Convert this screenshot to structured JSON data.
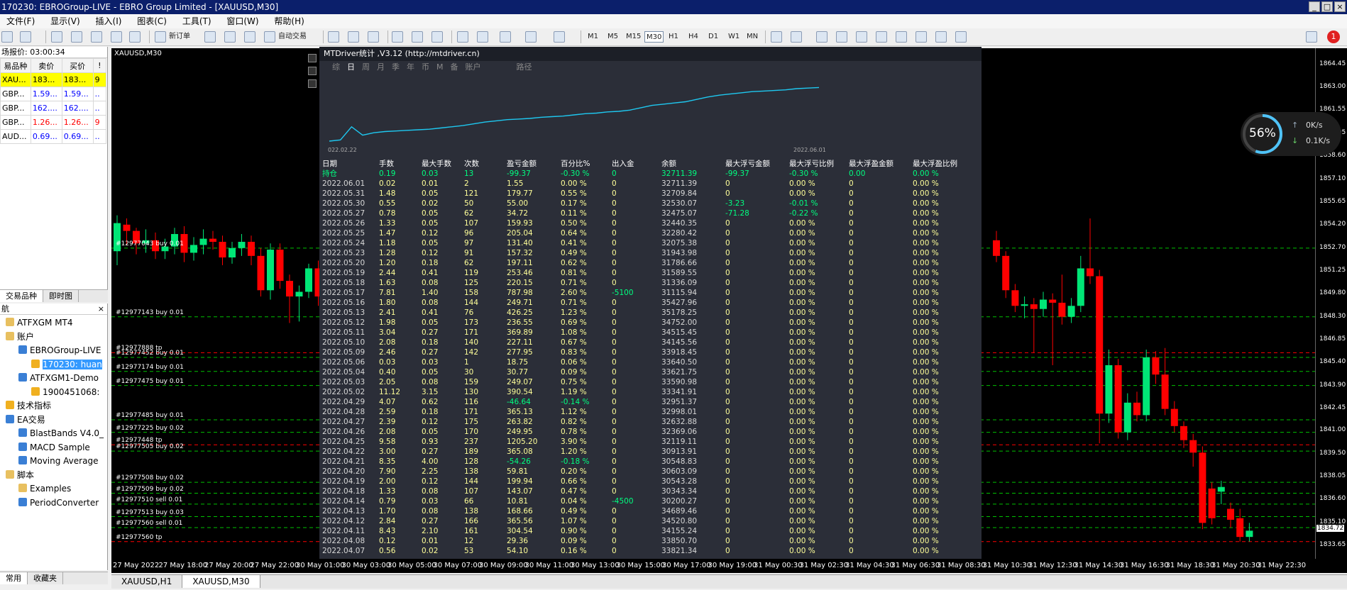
{
  "title": "170230: EBROGroup-LIVE - EBRO Group Limited - [XAUUSD,M30]",
  "window_controls": [
    "_",
    "□",
    "×"
  ],
  "menu": [
    "文件(F)",
    "显示(V)",
    "插入(I)",
    "图表(C)",
    "工具(T)",
    "窗口(W)",
    "帮助(H)"
  ],
  "toolbar": {
    "new_order": "新订单",
    "auto_trading": "自动交易",
    "timeframes": [
      "M1",
      "M5",
      "M15",
      "M30",
      "H1",
      "H4",
      "D1",
      "W1",
      "MN"
    ],
    "active_timeframe": "M30",
    "notification_count": "1"
  },
  "market_watch": {
    "header": "场报价: 03:00:34",
    "columns": [
      "易品种",
      "卖价",
      "买价",
      "!"
    ],
    "rows": [
      {
        "symbol": "XAU...",
        "bid": "183...",
        "ask": "183...",
        "spread": "9",
        "color": "#000000",
        "bg": "#ffff00"
      },
      {
        "symbol": "GBP...",
        "bid": "1.59...",
        "ask": "1.59...",
        "spread": "..",
        "color": "#0000ff",
        "bg": "#ffffff"
      },
      {
        "symbol": "GBP...",
        "bid": "162....",
        "ask": "162....",
        "spread": "..",
        "color": "#0000ff",
        "bg": "#ffffff"
      },
      {
        "symbol": "GBP...",
        "bid": "1.26...",
        "ask": "1.26...",
        "spread": "9",
        "color": "#ff0000",
        "bg": "#ffffff"
      },
      {
        "symbol": "AUD...",
        "bid": "0.69...",
        "ask": "0.69...",
        "spread": "..",
        "color": "#0000ff",
        "bg": "#ffffff"
      }
    ],
    "tabs": [
      "交易品种",
      "即时图"
    ]
  },
  "navigator": {
    "header": "航",
    "items": [
      {
        "label": "ATFXGM MT4",
        "indent": 0,
        "icon": "folder-icon"
      },
      {
        "label": "账户",
        "indent": 0,
        "icon": "accounts-icon"
      },
      {
        "label": "EBROGroup-LIVE",
        "indent": 1,
        "icon": "server-icon"
      },
      {
        "label": "170230: huan",
        "indent": 2,
        "icon": "user-icon",
        "selected": true
      },
      {
        "label": "ATFXGM1-Demo",
        "indent": 1,
        "icon": "server-icon"
      },
      {
        "label": "1900451068:",
        "indent": 2,
        "icon": "user-icon"
      },
      {
        "label": "技术指标",
        "indent": 0,
        "icon": "indicators-icon"
      },
      {
        "label": "EA交易",
        "indent": 0,
        "icon": "experts-icon"
      },
      {
        "label": "BlastBands V4.0_",
        "indent": 1,
        "icon": "expert-icon"
      },
      {
        "label": "MACD Sample",
        "indent": 1,
        "icon": "expert-icon"
      },
      {
        "label": "Moving Average",
        "indent": 1,
        "icon": "expert-icon"
      },
      {
        "label": "脚本",
        "indent": 0,
        "icon": "scripts-icon"
      },
      {
        "label": "Examples",
        "indent": 1,
        "icon": "folder-icon"
      },
      {
        "label": "PeriodConverter",
        "indent": 1,
        "icon": "script-icon"
      }
    ],
    "tabs": [
      "常用",
      "收藏夹"
    ]
  },
  "chart": {
    "symbol_label": "XAUUSD,M30",
    "current_price": "1834.72",
    "price_ticks": [
      "1864.45",
      "1863.00",
      "1861.55",
      "1860.05",
      "1858.60",
      "1857.10",
      "1855.65",
      "1854.20",
      "1852.70",
      "1851.25",
      "1849.80",
      "1848.30",
      "1846.85",
      "1845.40",
      "1843.90",
      "1842.45",
      "1841.00",
      "1839.50",
      "1838.05",
      "1836.60",
      "1835.10",
      "1833.65"
    ],
    "time_ticks": [
      "27 May 2022",
      "27 May 18:00",
      "27 May 20:00",
      "27 May 22:00",
      "30 May 01:00",
      "30 May 03:00",
      "30 May 05:00",
      "30 May 07:00",
      "30 May 09:00",
      "30 May 11:00",
      "30 May 13:00",
      "30 May 15:00",
      "30 May 17:00",
      "30 May 19:00",
      "31 May 00:30",
      "31 May 02:30",
      "31 May 04:30",
      "31 May 06:30",
      "31 May 08:30",
      "31 May 10:30",
      "31 May 12:30",
      "31 May 14:30",
      "31 May 16:30",
      "31 May 18:30",
      "31 May 20:30",
      "31 May 22:30"
    ],
    "order_labels": [
      {
        "text": "#12977043 buy 0.01",
        "price": 1852.7,
        "color": "#00c000"
      },
      {
        "text": "#12977143 buy 0.01",
        "price": 1848.3,
        "color": "#00c000"
      },
      {
        "text": "#12977888 tp",
        "price": 1846.0,
        "color": "#ff0000"
      },
      {
        "text": "#12977452 buy 0.01",
        "price": 1845.7,
        "color": "#00c000"
      },
      {
        "text": "#12977174 buy 0.01",
        "price": 1844.8,
        "color": "#00c000"
      },
      {
        "text": "#12977475 buy 0.01",
        "price": 1843.9,
        "color": "#00c000"
      },
      {
        "text": "#12977485 buy 0.01",
        "price": 1841.7,
        "color": "#00c000"
      },
      {
        "text": "#12977225 buy 0.02",
        "price": 1840.9,
        "color": "#00c000"
      },
      {
        "text": "#12977448 tp",
        "price": 1840.1,
        "color": "#ff0000"
      },
      {
        "text": "#12977505 buy 0.02",
        "price": 1839.7,
        "color": "#00c000"
      },
      {
        "text": "#12977508 buy 0.02",
        "price": 1837.7,
        "color": "#00c000"
      },
      {
        "text": "#12977509 buy 0.02",
        "price": 1837.0,
        "color": "#00c000"
      },
      {
        "text": "#12977510 sell 0.01",
        "price": 1836.3,
        "color": "#00c000"
      },
      {
        "text": "#12977513 buy 0.03",
        "price": 1835.5,
        "color": "#00c000"
      },
      {
        "text": "#12977560 sell 0.01",
        "price": 1834.8,
        "color": "#00c000"
      },
      {
        "text": "#12977560 tp",
        "price": 1833.9,
        "color": "#ff0000"
      }
    ],
    "candles_left": [
      [
        1852.5,
        1854.3,
        1854.8,
        1851.6
      ],
      [
        1854.2,
        1853.8,
        1854.6,
        1852.9
      ],
      [
        1853.8,
        1853.0,
        1854.0,
        1852.3
      ],
      [
        1853.0,
        1853.2,
        1853.9,
        1852.4
      ],
      [
        1853.2,
        1852.5,
        1853.7,
        1852.0
      ],
      [
        1852.5,
        1852.8,
        1853.3,
        1852.0
      ],
      [
        1852.8,
        1853.6,
        1854.0,
        1852.3
      ],
      [
        1853.6,
        1852.4,
        1854.1,
        1851.8
      ],
      [
        1852.4,
        1852.9,
        1853.4,
        1851.9
      ],
      [
        1852.9,
        1853.3,
        1853.9,
        1852.3
      ],
      [
        1853.3,
        1853.1,
        1853.8,
        1852.6
      ],
      [
        1853.1,
        1852.1,
        1853.5,
        1851.6
      ],
      [
        1852.1,
        1852.7,
        1853.1,
        1851.7
      ],
      [
        1852.7,
        1853.1,
        1853.6,
        1852.2
      ],
      [
        1853.1,
        1852.2,
        1853.5,
        1851.6
      ],
      [
        1852.2,
        1850.0,
        1852.7,
        1849.6
      ],
      [
        1850.0,
        1852.6,
        1853.0,
        1849.4
      ],
      [
        1852.6,
        1850.6,
        1853.0,
        1850.1
      ],
      [
        1850.6,
        1849.6,
        1851.0,
        1847.9
      ],
      [
        1849.6,
        1849.9,
        1850.3,
        1848.0
      ],
      [
        1849.9,
        1851.4,
        1851.7,
        1849.5
      ],
      [
        1851.4,
        1849.6,
        1851.9,
        1849.0
      ]
    ],
    "candles_right": [
      [
        1853.2,
        1852.2,
        1853.8,
        1851.8
      ],
      [
        1852.2,
        1850.0,
        1852.5,
        1849.5
      ],
      [
        1850.0,
        1849.0,
        1850.4,
        1848.6
      ],
      [
        1849.0,
        1849.1,
        1849.6,
        1848.2
      ],
      [
        1849.1,
        1848.8,
        1849.5,
        1846.0
      ],
      [
        1848.8,
        1849.4,
        1849.9,
        1848.3
      ],
      [
        1849.4,
        1849.2,
        1849.8,
        1845.2
      ],
      [
        1849.2,
        1848.3,
        1851.0,
        1847.8
      ],
      [
        1848.3,
        1849.0,
        1849.5,
        1847.9
      ],
      [
        1849.0,
        1851.4,
        1852.2,
        1848.6
      ],
      [
        1851.4,
        1850.9,
        1854.6,
        1850.4
      ],
      [
        1850.9,
        1842.1,
        1851.3,
        1840.2
      ],
      [
        1842.1,
        1845.2,
        1846.2,
        1841.5
      ],
      [
        1845.2,
        1840.9,
        1845.6,
        1840.5
      ],
      [
        1840.9,
        1842.8,
        1843.4,
        1840.4
      ],
      [
        1842.8,
        1842.0,
        1843.5,
        1841.6
      ],
      [
        1842.0,
        1845.7,
        1846.2,
        1841.6
      ],
      [
        1845.7,
        1844.6,
        1846.1,
        1844.0
      ],
      [
        1844.6,
        1842.4,
        1846.3,
        1842.0
      ],
      [
        1842.4,
        1841.3,
        1842.9,
        1840.9
      ],
      [
        1841.3,
        1840.4,
        1841.6,
        1839.9
      ],
      [
        1840.4,
        1839.6,
        1840.8,
        1838.7
      ],
      [
        1839.6,
        1835.1,
        1840.0,
        1834.7
      ],
      [
        1837.3,
        1835.4,
        1837.7,
        1835.0
      ],
      [
        1837.1,
        1837.4,
        1837.8,
        1836.3
      ],
      [
        1836.0,
        1835.3,
        1836.4,
        1834.8
      ],
      [
        1835.4,
        1834.2,
        1836.0,
        1833.9
      ],
      [
        1834.2,
        1834.6,
        1835.1,
        1833.9
      ]
    ]
  },
  "stats": {
    "title": "MTDriver统计 ,V3.12 (http://mtdriver.cn)",
    "tabs": [
      "综",
      "日",
      "周",
      "月",
      "季",
      "年",
      "币",
      "M",
      "备",
      "账户",
      "路径"
    ],
    "active_tab": "日",
    "equity_start_label": "022.02.22",
    "equity_end_label": "2022.06.01",
    "equity_curve": [
      0.06,
      0.08,
      0.3,
      0.16,
      0.2,
      0.22,
      0.23,
      0.24,
      0.25,
      0.26,
      0.28,
      0.3,
      0.32,
      0.35,
      0.38,
      0.4,
      0.42,
      0.43,
      0.44,
      0.46,
      0.47,
      0.48,
      0.5,
      0.52,
      0.53,
      0.55,
      0.56,
      0.58,
      0.62,
      0.66,
      0.68,
      0.7,
      0.72,
      0.76,
      0.8,
      0.83,
      0.85,
      0.87,
      0.89,
      0.9,
      0.91,
      0.92,
      0.94,
      0.95,
      0.96
    ],
    "columns": [
      "日期",
      "手数",
      "最大手数",
      "次数",
      "盈亏金额",
      "百分比%",
      "出入金",
      "余额",
      "最大浮亏金额",
      "最大浮亏比例",
      "最大浮盈金额",
      "最大浮盈比例"
    ],
    "holding": [
      "持仓",
      "0.19",
      "0.03",
      "13",
      "-99.37",
      "-0.30 %",
      "0",
      "32711.39",
      "-99.37",
      "-0.30 %",
      "0.00",
      "0.00 %"
    ],
    "rows": [
      [
        "2022.06.01",
        "0.02",
        "0.01",
        "2",
        "1.55",
        "0.00 %",
        "0",
        "32711.39",
        "0",
        "0.00 %",
        "0",
        "0.00 %"
      ],
      [
        "2022.05.31",
        "1.48",
        "0.05",
        "121",
        "179.77",
        "0.55 %",
        "0",
        "32709.84",
        "0",
        "0.00 %",
        "0",
        "0.00 %"
      ],
      [
        "2022.05.30",
        "0.55",
        "0.02",
        "50",
        "55.00",
        "0.17 %",
        "0",
        "32530.07",
        "-3.23",
        "-0.01 %",
        "0",
        "0.00 %"
      ],
      [
        "2022.05.27",
        "0.78",
        "0.05",
        "62",
        "34.72",
        "0.11 %",
        "0",
        "32475.07",
        "-71.28",
        "-0.22 %",
        "0",
        "0.00 %"
      ],
      [
        "2022.05.26",
        "1.33",
        "0.05",
        "107",
        "159.93",
        "0.50 %",
        "0",
        "32440.35",
        "0",
        "0.00 %",
        "0",
        "0.00 %"
      ],
      [
        "2022.05.25",
        "1.47",
        "0.12",
        "96",
        "205.04",
        "0.64 %",
        "0",
        "32280.42",
        "0",
        "0.00 %",
        "0",
        "0.00 %"
      ],
      [
        "2022.05.24",
        "1.18",
        "0.05",
        "97",
        "131.40",
        "0.41 %",
        "0",
        "32075.38",
        "0",
        "0.00 %",
        "0",
        "0.00 %"
      ],
      [
        "2022.05.23",
        "1.28",
        "0.12",
        "91",
        "157.32",
        "0.49 %",
        "0",
        "31943.98",
        "0",
        "0.00 %",
        "0",
        "0.00 %"
      ],
      [
        "2022.05.20",
        "1.20",
        "0.18",
        "62",
        "197.11",
        "0.62 %",
        "0",
        "31786.66",
        "0",
        "0.00 %",
        "0",
        "0.00 %"
      ],
      [
        "2022.05.19",
        "2.44",
        "0.41",
        "119",
        "253.46",
        "0.81 %",
        "0",
        "31589.55",
        "0",
        "0.00 %",
        "0",
        "0.00 %"
      ],
      [
        "2022.05.18",
        "1.63",
        "0.08",
        "125",
        "220.15",
        "0.71 %",
        "0",
        "31336.09",
        "0",
        "0.00 %",
        "0",
        "0.00 %"
      ],
      [
        "2022.05.17",
        "7.81",
        "1.40",
        "158",
        "787.98",
        "2.60 %",
        "-5100",
        "31115.94",
        "0",
        "0.00 %",
        "0",
        "0.00 %"
      ],
      [
        "2022.05.16",
        "1.80",
        "0.08",
        "144",
        "249.71",
        "0.71 %",
        "0",
        "35427.96",
        "0",
        "0.00 %",
        "0",
        "0.00 %"
      ],
      [
        "2022.05.13",
        "2.41",
        "0.41",
        "76",
        "426.25",
        "1.23 %",
        "0",
        "35178.25",
        "0",
        "0.00 %",
        "0",
        "0.00 %"
      ],
      [
        "2022.05.12",
        "1.98",
        "0.05",
        "173",
        "236.55",
        "0.69 %",
        "0",
        "34752.00",
        "0",
        "0.00 %",
        "0",
        "0.00 %"
      ],
      [
        "2022.05.11",
        "3.04",
        "0.27",
        "171",
        "369.89",
        "1.08 %",
        "0",
        "34515.45",
        "0",
        "0.00 %",
        "0",
        "0.00 %"
      ],
      [
        "2022.05.10",
        "2.08",
        "0.18",
        "140",
        "227.11",
        "0.67 %",
        "0",
        "34145.56",
        "0",
        "0.00 %",
        "0",
        "0.00 %"
      ],
      [
        "2022.05.09",
        "2.46",
        "0.27",
        "142",
        "277.95",
        "0.83 %",
        "0",
        "33918.45",
        "0",
        "0.00 %",
        "0",
        "0.00 %"
      ],
      [
        "2022.05.06",
        "0.03",
        "0.03",
        "1",
        "18.75",
        "0.06 %",
        "0",
        "33640.50",
        "0",
        "0.00 %",
        "0",
        "0.00 %"
      ],
      [
        "2022.05.04",
        "0.40",
        "0.05",
        "30",
        "30.77",
        "0.09 %",
        "0",
        "33621.75",
        "0",
        "0.00 %",
        "0",
        "0.00 %"
      ],
      [
        "2022.05.03",
        "2.05",
        "0.08",
        "159",
        "249.07",
        "0.75 %",
        "0",
        "33590.98",
        "0",
        "0.00 %",
        "0",
        "0.00 %"
      ],
      [
        "2022.05.02",
        "11.12",
        "3.15",
        "130",
        "390.54",
        "1.19 %",
        "0",
        "33341.91",
        "0",
        "0.00 %",
        "0",
        "0.00 %"
      ],
      [
        "2022.04.29",
        "4.07",
        "0.62",
        "116",
        "-46.64",
        "-0.14 %",
        "0",
        "32951.37",
        "0",
        "0.00 %",
        "0",
        "0.00 %"
      ],
      [
        "2022.04.28",
        "2.59",
        "0.18",
        "171",
        "365.13",
        "1.12 %",
        "0",
        "32998.01",
        "0",
        "0.00 %",
        "0",
        "0.00 %"
      ],
      [
        "2022.04.27",
        "2.39",
        "0.12",
        "175",
        "263.82",
        "0.82 %",
        "0",
        "32632.88",
        "0",
        "0.00 %",
        "0",
        "0.00 %"
      ],
      [
        "2022.04.26",
        "2.08",
        "0.05",
        "170",
        "249.95",
        "0.78 %",
        "0",
        "32369.06",
        "0",
        "0.00 %",
        "0",
        "0.00 %"
      ],
      [
        "2022.04.25",
        "9.58",
        "0.93",
        "237",
        "1205.20",
        "3.90 %",
        "0",
        "32119.11",
        "0",
        "0.00 %",
        "0",
        "0.00 %"
      ],
      [
        "2022.04.22",
        "3.00",
        "0.27",
        "189",
        "365.08",
        "1.20 %",
        "0",
        "30913.91",
        "0",
        "0.00 %",
        "0",
        "0.00 %"
      ],
      [
        "2022.04.21",
        "8.35",
        "4.00",
        "128",
        "-54.26",
        "-0.18 %",
        "0",
        "30548.83",
        "0",
        "0.00 %",
        "0",
        "0.00 %"
      ],
      [
        "2022.04.20",
        "7.90",
        "2.25",
        "138",
        "59.81",
        "0.20 %",
        "0",
        "30603.09",
        "0",
        "0.00 %",
        "0",
        "0.00 %"
      ],
      [
        "2022.04.19",
        "2.00",
        "0.12",
        "144",
        "199.94",
        "0.66 %",
        "0",
        "30543.28",
        "0",
        "0.00 %",
        "0",
        "0.00 %"
      ],
      [
        "2022.04.18",
        "1.33",
        "0.08",
        "107",
        "143.07",
        "0.47 %",
        "0",
        "30343.34",
        "0",
        "0.00 %",
        "0",
        "0.00 %"
      ],
      [
        "2022.04.14",
        "0.79",
        "0.03",
        "66",
        "10.81",
        "0.04 %",
        "-4500",
        "30200.27",
        "0",
        "0.00 %",
        "0",
        "0.00 %"
      ],
      [
        "2022.04.13",
        "1.70",
        "0.08",
        "138",
        "168.66",
        "0.49 %",
        "0",
        "34689.46",
        "0",
        "0.00 %",
        "0",
        "0.00 %"
      ],
      [
        "2022.04.12",
        "2.84",
        "0.27",
        "166",
        "365.56",
        "1.07 %",
        "0",
        "34520.80",
        "0",
        "0.00 %",
        "0",
        "0.00 %"
      ],
      [
        "2022.04.11",
        "8.43",
        "2.10",
        "161",
        "304.54",
        "0.90 %",
        "0",
        "34155.24",
        "0",
        "0.00 %",
        "0",
        "0.00 %"
      ],
      [
        "2022.04.08",
        "0.12",
        "0.01",
        "12",
        "29.36",
        "0.09 %",
        "0",
        "33850.70",
        "0",
        "0.00 %",
        "0",
        "0.00 %"
      ],
      [
        "2022.04.07",
        "0.56",
        "0.02",
        "53",
        "54.10",
        "0.16 %",
        "0",
        "33821.34",
        "0",
        "0.00 %",
        "0",
        "0.00 %"
      ]
    ]
  },
  "net_monitor": {
    "percent": "56%",
    "upload": "0K/s",
    "download": "0.1K/s",
    "percent_value": 56
  },
  "bottom_tabs": [
    "XAUUSD,H1",
    "XAUUSD,M30"
  ],
  "active_bottom_tab": "XAUUSD,M30",
  "colors": {
    "bull": "#00e676",
    "bear": "#ff0000",
    "curve": "#1ec8f0",
    "stat_text": "#ffff99",
    "stat_pos": "#00ff80",
    "stat_neg": "#ffff99"
  }
}
